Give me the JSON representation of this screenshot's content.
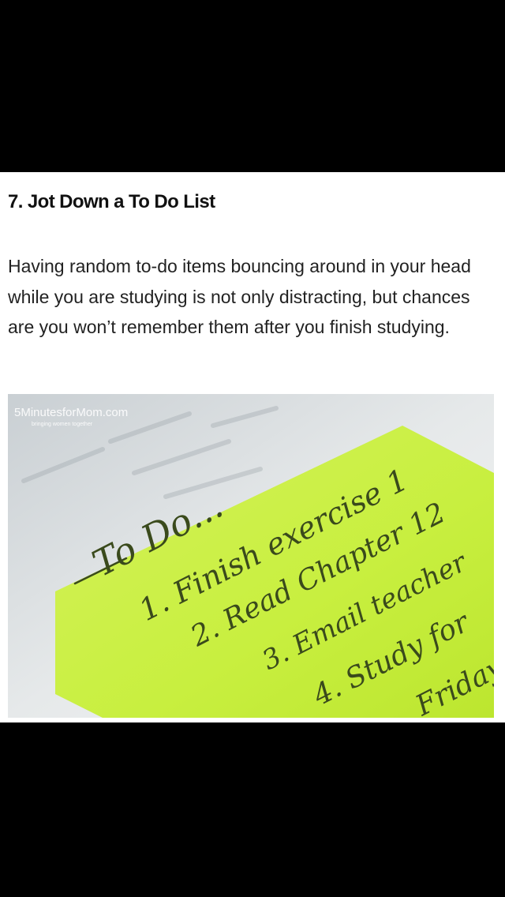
{
  "article": {
    "heading": "7. Jot Down a To Do List",
    "paragraph": "Having random to-do items bouncing around in your head while you are studying is not only distracting, but chances are you won’t remember them after you finish studying."
  },
  "image": {
    "watermark_brand": "5MinutesforMom.com",
    "watermark_tagline": "bringing women together",
    "note_lines": [
      "To Do...",
      "1. Finish exercise 1",
      "2. Read Chapter 12",
      "3. Email teacher",
      "4. Study for",
      "Friday"
    ],
    "note_color": "#c8ef3f"
  }
}
